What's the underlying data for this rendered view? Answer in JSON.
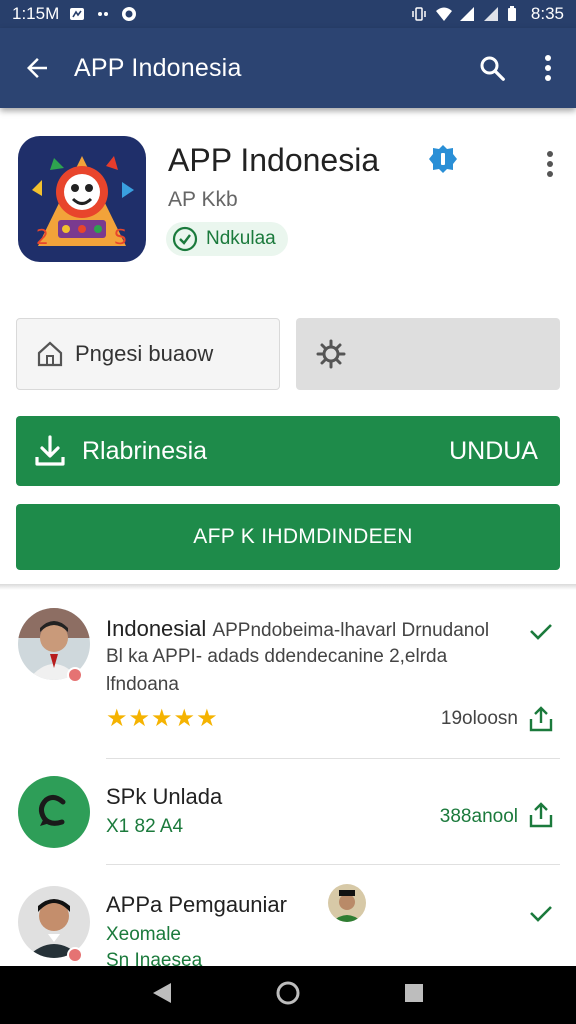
{
  "status_bar": {
    "time_left": "1:15M",
    "time_right": "8:35"
  },
  "app_bar": {
    "title": "APP Indonesia"
  },
  "app": {
    "name": "APP Indonesia",
    "developer": "AP Kkb",
    "badge": "Ndkulaa",
    "secondary_button": "Pngesi buaow",
    "install_label": "Rlabrinesia",
    "install_right": "UNDUA",
    "second_button": "AFP K IHDMDINDEEN"
  },
  "list": [
    {
      "title": "Indonesial",
      "title_rest": "APPndobeima-lhavarl Drnudanol",
      "line2": "Bl ka APPI- adads ddendecanine 2,elrda",
      "line3": "lfndoana",
      "rating": 4.5,
      "stars": "★★★★★",
      "meta": "19oloosn"
    },
    {
      "title": "SPk Unlada",
      "line2": "X1 82 A4",
      "meta": "388anool"
    },
    {
      "title": "APPa Pemgauniar",
      "line2": "Xeomale",
      "line3": "Sn Inaesea"
    }
  ],
  "colors": {
    "app_bar": "#2c4472",
    "status_bar": "#283f6b",
    "primary_green": "#1e8b4a",
    "star": "#f5b301"
  }
}
